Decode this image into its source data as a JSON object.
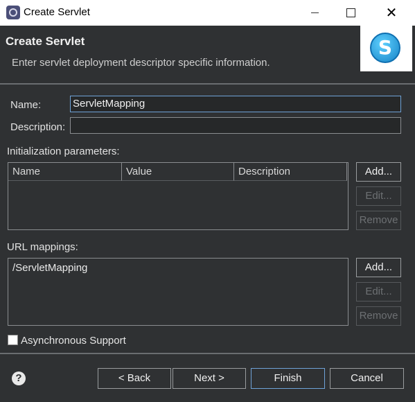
{
  "window": {
    "title": "Create Servlet",
    "min_label": "",
    "close_label": "✕"
  },
  "header": {
    "title": "Create Servlet",
    "subtitle": "Enter servlet deployment descriptor specific information.",
    "logo_letter": "S"
  },
  "form": {
    "name_label": "Name:",
    "name_value": "ServletMapping",
    "description_label": "Description:",
    "description_value": ""
  },
  "init_params": {
    "label": "Initialization parameters:",
    "columns": [
      "Name",
      "Value",
      "Description"
    ],
    "add_label": "Add...",
    "edit_label": "Edit...",
    "remove_label": "Remove"
  },
  "url_mappings": {
    "label": "URL mappings:",
    "items": [
      "/ServletMapping"
    ],
    "add_label": "Add...",
    "edit_label": "Edit...",
    "remove_label": "Remove"
  },
  "async": {
    "label": "Asynchronous Support",
    "checked": false
  },
  "footer": {
    "help_label": "?",
    "back_label": "< Back",
    "next_label": "Next >",
    "finish_label": "Finish",
    "cancel_label": "Cancel"
  },
  "colors": {
    "background": "#2f3133",
    "focus_border": "#6fa3d8"
  }
}
